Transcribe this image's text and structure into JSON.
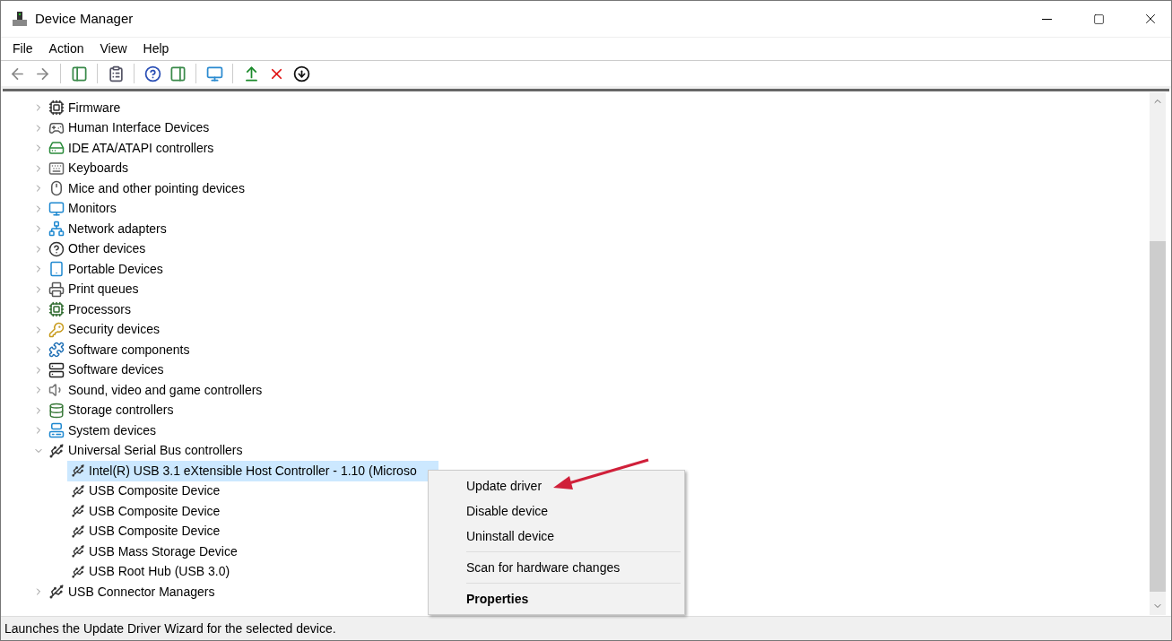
{
  "window": {
    "title": "Device Manager"
  },
  "menu_bar": [
    "File",
    "Action",
    "View",
    "Help"
  ],
  "tree": [
    {
      "label": "Firmware",
      "expanded": false,
      "selected": false
    },
    {
      "label": "Human Interface Devices",
      "expanded": false,
      "selected": false
    },
    {
      "label": "IDE ATA/ATAPI controllers",
      "expanded": false,
      "selected": false
    },
    {
      "label": "Keyboards",
      "expanded": false,
      "selected": false
    },
    {
      "label": "Mice and other pointing devices",
      "expanded": false,
      "selected": false
    },
    {
      "label": "Monitors",
      "expanded": false,
      "selected": false
    },
    {
      "label": "Network adapters",
      "expanded": false,
      "selected": false
    },
    {
      "label": "Other devices",
      "expanded": false,
      "selected": false
    },
    {
      "label": "Portable Devices",
      "expanded": false,
      "selected": false
    },
    {
      "label": "Print queues",
      "expanded": false,
      "selected": false
    },
    {
      "label": "Processors",
      "expanded": false,
      "selected": false
    },
    {
      "label": "Security devices",
      "expanded": false,
      "selected": false
    },
    {
      "label": "Software components",
      "expanded": false,
      "selected": false
    },
    {
      "label": "Software devices",
      "expanded": false,
      "selected": false
    },
    {
      "label": "Sound, video and game controllers",
      "expanded": false,
      "selected": false
    },
    {
      "label": "Storage controllers",
      "expanded": false,
      "selected": false
    },
    {
      "label": "System devices",
      "expanded": false,
      "selected": false
    },
    {
      "label": "Universal Serial Bus controllers",
      "expanded": true,
      "selected": false,
      "children": [
        {
          "label": "Intel(R) USB 3.1 eXtensible Host Controller - 1.10 (Microso",
          "selected": true
        },
        {
          "label": "USB Composite Device",
          "selected": false
        },
        {
          "label": "USB Composite Device",
          "selected": false
        },
        {
          "label": "USB Composite Device",
          "selected": false
        },
        {
          "label": "USB Mass Storage Device",
          "selected": false
        },
        {
          "label": "USB Root Hub (USB 3.0)",
          "selected": false
        }
      ]
    },
    {
      "label": "USB Connector Managers",
      "expanded": false,
      "selected": false
    }
  ],
  "context_menu": [
    {
      "kind": "item",
      "label": "Update driver",
      "default": false
    },
    {
      "kind": "item",
      "label": "Disable device",
      "default": false
    },
    {
      "kind": "item",
      "label": "Uninstall device",
      "default": false
    },
    {
      "kind": "separator"
    },
    {
      "kind": "item",
      "label": "Scan for hardware changes",
      "default": false
    },
    {
      "kind": "separator"
    },
    {
      "kind": "item",
      "label": "Properties",
      "default": true
    }
  ],
  "status_bar": "Launches the Update Driver Wizard for the selected device."
}
